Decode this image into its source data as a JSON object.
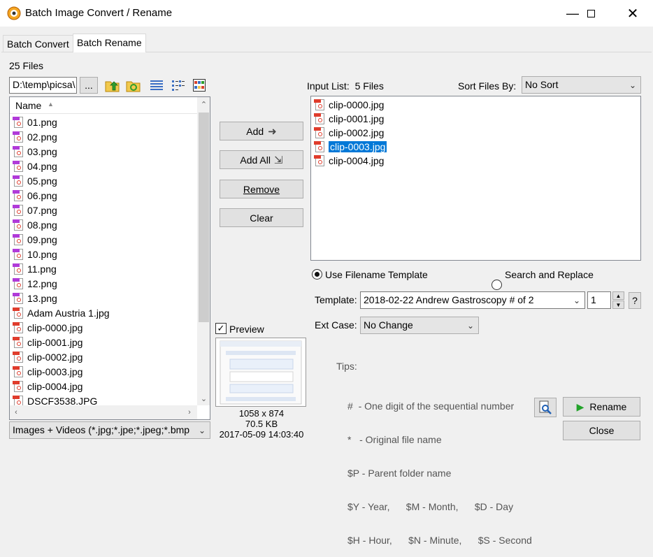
{
  "window": {
    "title": "Batch Image Convert / Rename"
  },
  "tabs": [
    {
      "label": "Batch Convert"
    },
    {
      "label": "Batch Rename"
    }
  ],
  "left": {
    "file_count": "25 Files",
    "path": "D:\\temp\\picsa\\",
    "browse_label": "...",
    "column_name": "Name",
    "files": [
      {
        "name": "01.png",
        "type": "png"
      },
      {
        "name": "02.png",
        "type": "png"
      },
      {
        "name": "03.png",
        "type": "png"
      },
      {
        "name": "04.png",
        "type": "png"
      },
      {
        "name": "05.png",
        "type": "png"
      },
      {
        "name": "06.png",
        "type": "png"
      },
      {
        "name": "07.png",
        "type": "png"
      },
      {
        "name": "08.png",
        "type": "png"
      },
      {
        "name": "09.png",
        "type": "png"
      },
      {
        "name": "10.png",
        "type": "png"
      },
      {
        "name": "11.png",
        "type": "png"
      },
      {
        "name": "12.png",
        "type": "png"
      },
      {
        "name": "13.png",
        "type": "png"
      },
      {
        "name": "Adam Austria 1.jpg",
        "type": "jpg"
      },
      {
        "name": "clip-0000.jpg",
        "type": "jpg"
      },
      {
        "name": "clip-0001.jpg",
        "type": "jpg"
      },
      {
        "name": "clip-0002.jpg",
        "type": "jpg"
      },
      {
        "name": "clip-0003.jpg",
        "type": "jpg"
      },
      {
        "name": "clip-0004.jpg",
        "type": "jpg"
      },
      {
        "name": "DSCF3538.JPG",
        "type": "jpg"
      }
    ],
    "filter": "Images + Videos (*.jpg;*.jpe;*.jpeg;*.bmp"
  },
  "middle": {
    "add_label": "Add",
    "add_all_label": "Add All",
    "remove_label": "Remove",
    "clear_label": "Clear",
    "preview_label": "Preview",
    "preview_checked": true,
    "preview_dimensions": "1058 x 874",
    "preview_size": "70.5 KB",
    "preview_date": "2017-05-09 14:03:40"
  },
  "right": {
    "input_list_label": "Input List:",
    "input_list_count": "5 Files",
    "sort_label": "Sort Files By:",
    "sort_value": "No Sort",
    "files": [
      {
        "name": "clip-0000.jpg",
        "selected": false
      },
      {
        "name": "clip-0001.jpg",
        "selected": false
      },
      {
        "name": "clip-0002.jpg",
        "selected": false
      },
      {
        "name": "clip-0003.jpg",
        "selected": true
      },
      {
        "name": "clip-0004.jpg",
        "selected": false
      }
    ],
    "option_template": "Use Filename Template",
    "option_search": "Search and Replace",
    "selected_option": "template",
    "template_label": "Template:",
    "template_value": "2018-02-22 Andrew Gastroscopy # of 2",
    "start_number": "1",
    "help_label": "?",
    "ext_case_label": "Ext Case:",
    "ext_case_value": "No Change",
    "tips_label": "Tips:",
    "tips": [
      "#  - One digit of the sequential number",
      "*   - Original file name",
      "$P - Parent folder name",
      "$Y - Year,      $M - Month,      $D - Day",
      "$H - Hour,      $N - Minute,      $S - Second"
    ],
    "rename_label": "Rename",
    "close_label": "Close"
  },
  "colors": {
    "selection": "#0078d7",
    "png_tag": "#b13ad9",
    "jpg_tag": "#e03c2c",
    "play": "#22a32a"
  }
}
